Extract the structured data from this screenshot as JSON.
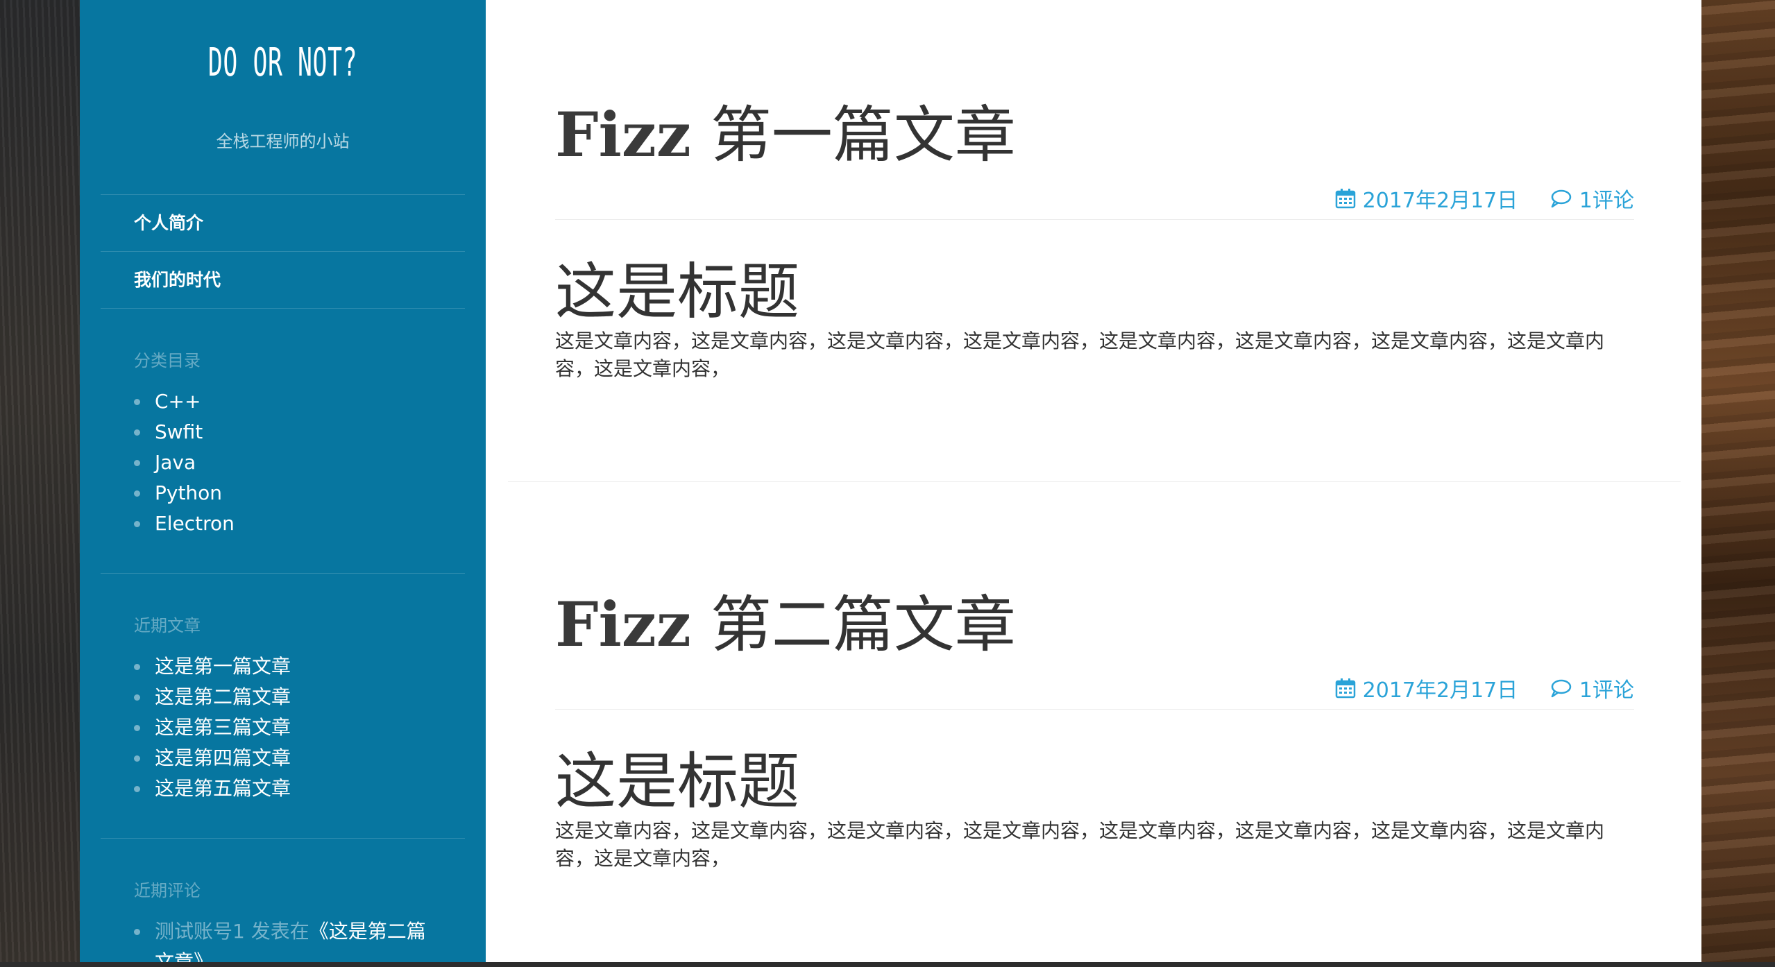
{
  "site": {
    "title": "DO OR NOT?",
    "subtitle": "全栈工程师的小站"
  },
  "nav": {
    "items": [
      {
        "label": "个人简介"
      },
      {
        "label": "我们的时代"
      }
    ]
  },
  "categories": {
    "title": "分类目录",
    "items": [
      "C++",
      "Swfit",
      "Java",
      "Python",
      "Electron"
    ]
  },
  "recent_posts": {
    "title": "近期文章",
    "items": [
      "这是第一篇文章",
      "这是第二篇文章",
      "这是第三篇文章",
      "这是第四篇文章",
      "这是第五篇文章"
    ]
  },
  "recent_comments": {
    "title": "近期评论",
    "items": [
      {
        "author_prefix": "测试账号1 发表在",
        "link": "《这是第二篇",
        "link_cont": "文章》"
      }
    ]
  },
  "articles": [
    {
      "title_fizz": "Fizz",
      "title_rest": "第一篇文章",
      "date": "2017年2月17日",
      "comments": "1评论",
      "heading": "这是标题",
      "body_line1": "这是文章内容，这是文章内容，这是文章内容，这是文章内容，这是文章内容，这是文章内容，这是文章内容，这是文章内",
      "body_line2": "容，这是文章内容，"
    },
    {
      "title_fizz": "Fizz",
      "title_rest": "第二篇文章",
      "date": "2017年2月17日",
      "comments": "1评论",
      "heading": "这是标题",
      "body_line1": "这是文章内容，这是文章内容，这是文章内容，这是文章内容，这是文章内容，这是文章内容，这是文章内容，这是文章内",
      "body_line2": "容，这是文章内容，"
    }
  ],
  "icons": {
    "date": "calendar-icon",
    "comments": "comment-bubble-icon"
  },
  "colors": {
    "sidebar": "#0776a0",
    "accent": "#2aa3d8",
    "text": "#333333"
  }
}
